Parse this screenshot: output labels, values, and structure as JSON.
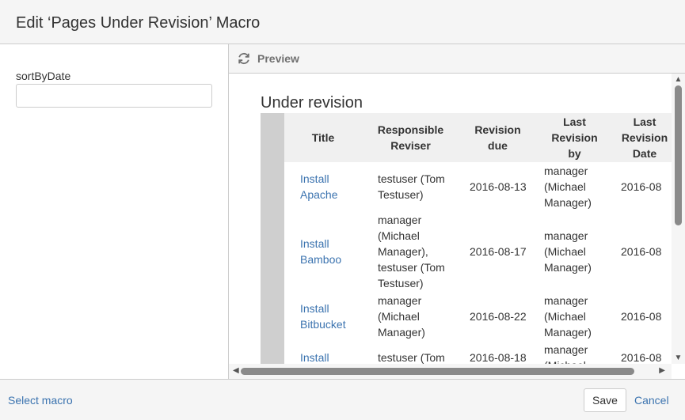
{
  "dialog": {
    "title": "Edit ‘Pages Under Revision’ Macro"
  },
  "params": {
    "sort_label": "sortByDate",
    "sort_value": ""
  },
  "preview": {
    "label": "Preview",
    "heading": "Under revision"
  },
  "table": {
    "headers": {
      "title": "Title",
      "resp": "Responsible Reviser",
      "due": "Revision due",
      "by": "Last Revision by",
      "date": "Last Revision Date"
    },
    "rows": [
      {
        "title": "Install Apache",
        "resp": "testuser (Tom Testuser)",
        "due": "2016-08-13",
        "by": "manager (Michael Manager)",
        "date": "2016-08"
      },
      {
        "title": "Install Bamboo",
        "resp": "manager (Michael Manager), testuser (Tom Testuser)",
        "due": "2016-08-17",
        "by": "manager (Michael Manager)",
        "date": "2016-08"
      },
      {
        "title": "Install Bitbucket",
        "resp": "manager (Michael Manager)",
        "due": "2016-08-22",
        "by": "manager (Michael Manager)",
        "date": "2016-08"
      },
      {
        "title": "Install",
        "resp": "testuser (Tom",
        "due": "2016-08-18",
        "by": "manager (Michael",
        "date": "2016-08"
      }
    ]
  },
  "footer": {
    "select_macro": "Select macro",
    "save": "Save",
    "cancel": "Cancel"
  },
  "colors": {
    "link": "#3b73af",
    "header_bg": "#f5f5f5",
    "border": "#cccccc"
  },
  "icons": {
    "refresh": "refresh-icon"
  }
}
